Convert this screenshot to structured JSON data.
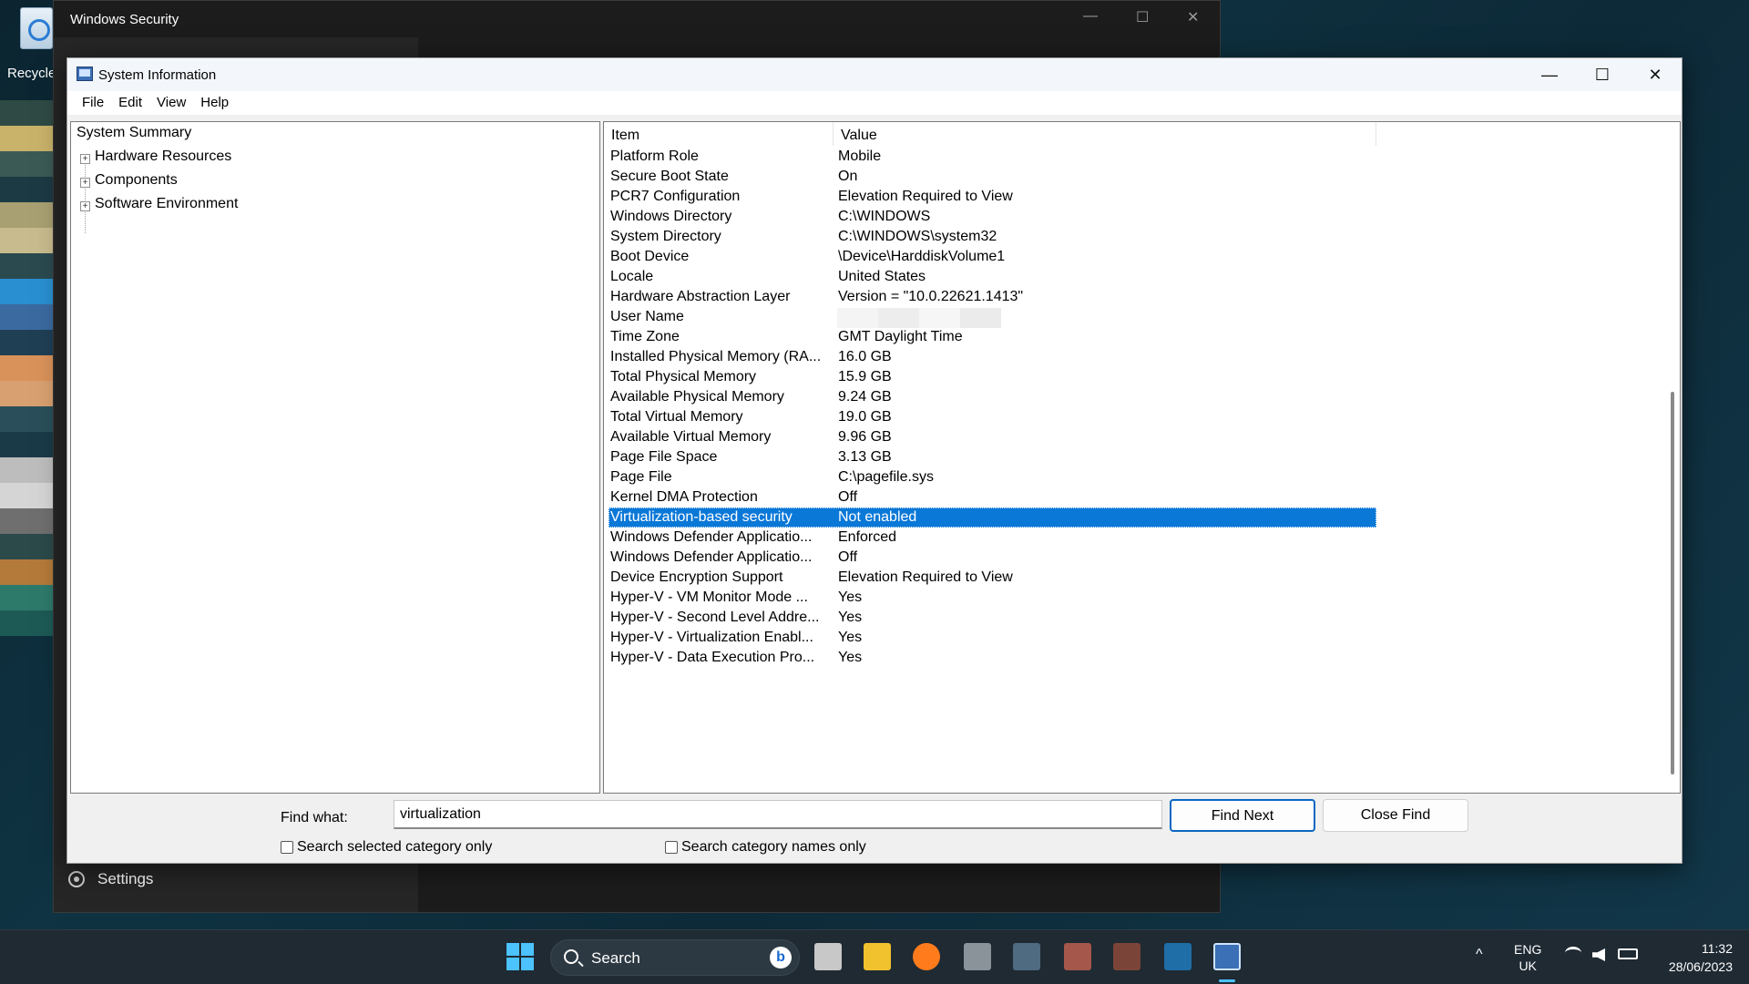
{
  "desktop": {
    "recycle_label": "Recycle",
    "blocks": [
      "#2f4a44",
      "#c9b26a",
      "#3b5a55",
      "#1c3a44",
      "#a8a072",
      "#c8bb8d",
      "#2a4a50",
      "#2a8fd0",
      "#3b6aa0",
      "#1f3f55",
      "#d9925a",
      "#d8a070",
      "#2a4f5a",
      "#1a3a48",
      "#bdbdbd",
      "#d5d5d5",
      "#6f6f6f",
      "#2c4a4a",
      "#b47a3a",
      "#2e7a6a",
      "#1d5a55"
    ]
  },
  "winsec": {
    "title": "Windows Security",
    "settings_label": "Settings",
    "min": "—",
    "max": "☐",
    "close": "✕"
  },
  "sysinfo": {
    "title": "System Information",
    "min": "—",
    "max": "☐",
    "close": "✕",
    "menu": [
      "File",
      "Edit",
      "View",
      "Help"
    ],
    "tree": {
      "root": "System Summary",
      "children": [
        "Hardware Resources",
        "Components",
        "Software Environment"
      ]
    },
    "columns": [
      "Item",
      "Value"
    ],
    "rows": [
      {
        "item": "Platform Role",
        "value": "Mobile"
      },
      {
        "item": "Secure Boot State",
        "value": "On"
      },
      {
        "item": "PCR7 Configuration",
        "value": "Elevation Required to View"
      },
      {
        "item": "Windows Directory",
        "value": "C:\\WINDOWS"
      },
      {
        "item": "System Directory",
        "value": "C:\\WINDOWS\\system32"
      },
      {
        "item": "Boot Device",
        "value": "\\Device\\HarddiskVolume1"
      },
      {
        "item": "Locale",
        "value": "United States"
      },
      {
        "item": "Hardware Abstraction Layer",
        "value": "Version = \"10.0.22621.1413\""
      },
      {
        "item": "User Name",
        "value": ""
      },
      {
        "item": "Time Zone",
        "value": "GMT Daylight Time"
      },
      {
        "item": "Installed Physical Memory (RA...",
        "value": "16.0 GB"
      },
      {
        "item": "Total Physical Memory",
        "value": "15.9 GB"
      },
      {
        "item": "Available Physical Memory",
        "value": "9.24 GB"
      },
      {
        "item": "Total Virtual Memory",
        "value": "19.0 GB"
      },
      {
        "item": "Available Virtual Memory",
        "value": "9.96 GB"
      },
      {
        "item": "Page File Space",
        "value": "3.13 GB"
      },
      {
        "item": "Page File",
        "value": "C:\\pagefile.sys"
      },
      {
        "item": "Kernel DMA Protection",
        "value": "Off"
      },
      {
        "item": "Virtualization-based security",
        "value": "Not enabled"
      },
      {
        "item": "Windows Defender Applicatio...",
        "value": "Enforced"
      },
      {
        "item": "Windows Defender Applicatio...",
        "value": "Off"
      },
      {
        "item": "Device Encryption Support",
        "value": "Elevation Required to View"
      },
      {
        "item": "Hyper-V - VM Monitor Mode ...",
        "value": "Yes"
      },
      {
        "item": "Hyper-V - Second Level Addre...",
        "value": "Yes"
      },
      {
        "item": "Hyper-V - Virtualization Enabl...",
        "value": "Yes"
      },
      {
        "item": "Hyper-V - Data Execution Pro...",
        "value": "Yes"
      }
    ],
    "selected_row": 18,
    "find": {
      "label": "Find what:",
      "value": "virtualization",
      "find_next": "Find Next",
      "close_find": "Close Find",
      "search_selected": "Search selected category only",
      "search_names": "Search category names only"
    }
  },
  "taskbar": {
    "search_label": "Search",
    "bing_glyph": "b",
    "lang_top": "ENG",
    "lang_bottom": "UK",
    "time": "11:32",
    "date": "28/06/2023",
    "chevron": "^",
    "accent": "#4cc2ff"
  }
}
